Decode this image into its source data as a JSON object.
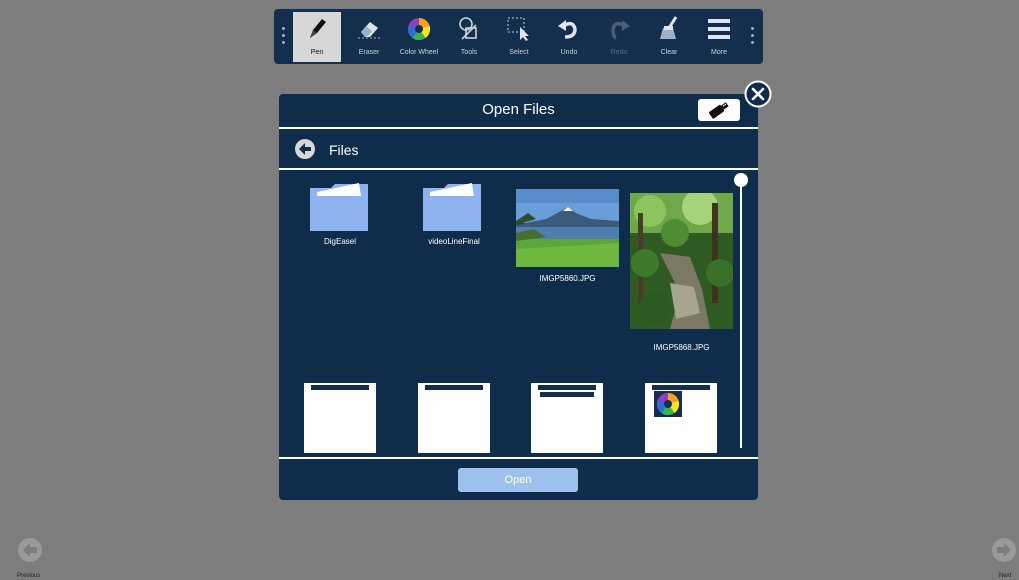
{
  "toolbar": {
    "tools": [
      {
        "label": "Pen",
        "icon": "pen-icon",
        "state": "active"
      },
      {
        "label": "Eraser",
        "icon": "eraser-icon",
        "state": "normal"
      },
      {
        "label": "Color Wheel",
        "icon": "color-wheel-icon",
        "state": "normal"
      },
      {
        "label": "Tools",
        "icon": "shapes-tools-icon",
        "state": "normal"
      },
      {
        "label": "Select",
        "icon": "select-icon",
        "state": "normal"
      },
      {
        "label": "Undo",
        "icon": "undo-icon",
        "state": "normal"
      },
      {
        "label": "Redo",
        "icon": "redo-icon",
        "state": "disabled"
      },
      {
        "label": "Clear",
        "icon": "broom-icon",
        "state": "normal"
      },
      {
        "label": "More",
        "icon": "hamburger-menu-icon",
        "state": "normal"
      }
    ]
  },
  "dialog": {
    "title": "Open Files",
    "usb_icon": "usb-drive-icon",
    "close_icon": "close-icon",
    "back_icon": "back-arrow-icon",
    "path_label": "Files",
    "items": [
      {
        "name": "DigEasel",
        "type": "folder"
      },
      {
        "name": "videoLineFinal",
        "type": "folder"
      },
      {
        "name": "IMGP5860.JPG",
        "type": "image-lake"
      },
      {
        "name": "IMGP5868.JPG",
        "type": "image-forest"
      },
      {
        "name": "",
        "type": "drawing"
      },
      {
        "name": "",
        "type": "drawing"
      },
      {
        "name": "",
        "type": "drawing"
      },
      {
        "name": "",
        "type": "drawing-colorwheel"
      }
    ],
    "open_label": "Open"
  },
  "footer": {
    "previous_label": "Previous",
    "next_label": "Next"
  },
  "colors": {
    "background": "#7d7d7d",
    "toolbar": "#142f4d",
    "dialog": "#0f2d4b",
    "folder": "#8fb3f0",
    "open_button": "#9dc1ec"
  }
}
